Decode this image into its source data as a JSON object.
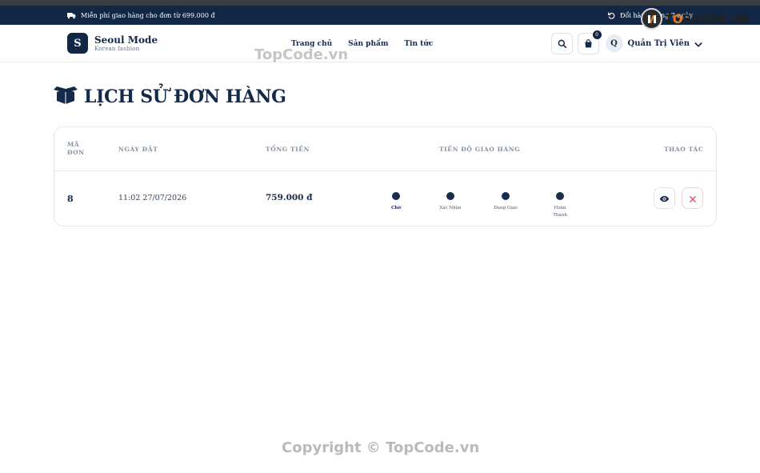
{
  "promo": {
    "shipping_text": "Miễn phí giao hàng cho đơn từ 699.000 đ",
    "return_text": "Đổi hàng trong 7 ngày"
  },
  "brand": {
    "logo_letter": "S",
    "name": "Seoul Mode",
    "tagline": "Korean fashion"
  },
  "nav": {
    "items": [
      {
        "label": "Trang chủ"
      },
      {
        "label": "Sản phẩm"
      },
      {
        "label": "Tin tức"
      }
    ]
  },
  "header_actions": {
    "cart_count": "0",
    "user_initial": "Q",
    "user_name": "Quản Trị Viên"
  },
  "watermark": {
    "logo_text_1": "T",
    "logo_text_o": "O",
    "logo_text_2": "PCODE.VN",
    "text": "TopCode.vn",
    "copyright": "Copyright © TopCode.vn"
  },
  "page": {
    "title": "LỊCH SỬ ĐƠN HÀNG"
  },
  "orders_table": {
    "columns": {
      "id_line1": "MÃ",
      "id_line2": "ĐƠN",
      "date": "NGÀY ĐẶT",
      "total": "TỔNG TIỀN",
      "progress": "TIẾN ĐỘ GIAO HÀNG",
      "actions": "THAO TÁC"
    },
    "rows": [
      {
        "id": "8",
        "date": "11:02 27/07/2026",
        "total": "759.000 đ",
        "steps": [
          {
            "label": "Chờ",
            "active": true
          },
          {
            "label": "Xác Nhận",
            "active": false
          },
          {
            "label": "Đang Giao",
            "active": false
          },
          {
            "label": "Hoàn Thành",
            "active": false
          }
        ]
      }
    ]
  },
  "colors": {
    "navy": "#122645",
    "text": "#15294a",
    "cancel": "#e0566f",
    "watermark_orange": "#f07a18"
  }
}
